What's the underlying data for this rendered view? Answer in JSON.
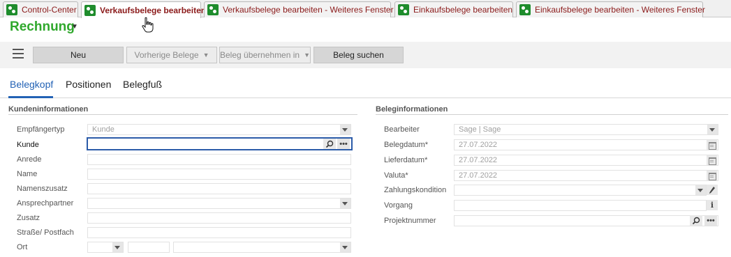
{
  "window_tabs": [
    {
      "label": "Control-Center",
      "icon": "app-icon",
      "active": false
    },
    {
      "label": "Verkaufsbelege bearbeiten",
      "icon": "app-icon",
      "active": true
    },
    {
      "label": "Verkaufsbelege bearbeiten - Weiteres Fenster",
      "icon": "app-icon",
      "active": false
    },
    {
      "label": "Einkaufsbelege bearbeiten",
      "icon": "app-icon",
      "active": false
    },
    {
      "label": "Einkaufsbelege bearbeiten - Weiteres Fenster",
      "icon": "app-icon",
      "active": false
    }
  ],
  "document": {
    "title": "Rechnung",
    "title_color": "#2fa82c"
  },
  "toolbar": {
    "menu_icon": "hamburger-icon",
    "new_label": "Neu",
    "previous_label": "Vorherige Belege",
    "take_over_label": "Beleg übernehmen in",
    "search_label": "Beleg suchen"
  },
  "section_tabs": [
    {
      "label": "Belegkopf",
      "active": true
    },
    {
      "label": "Positionen",
      "active": false
    },
    {
      "label": "Belegfuß",
      "active": false
    }
  ],
  "accent_color": "#2262b5",
  "customer": {
    "heading": "Kundeninformationen",
    "fields": {
      "recipient_type": {
        "label": "Empfängertyp",
        "value": "Kunde"
      },
      "customer": {
        "label": "Kunde",
        "value": ""
      },
      "salutation": {
        "label": "Anrede",
        "value": ""
      },
      "name": {
        "label": "Name",
        "value": ""
      },
      "name_suffix": {
        "label": "Namenszusatz",
        "value": ""
      },
      "contact": {
        "label": "Ansprechpartner",
        "value": ""
      },
      "addition": {
        "label": "Zusatz",
        "value": ""
      },
      "street": {
        "label": "Straße/ Postfach",
        "value": ""
      },
      "city": {
        "label": "Ort",
        "value": ""
      }
    }
  },
  "document_info": {
    "heading": "Beleginformationen",
    "fields": {
      "editor": {
        "label": "Bearbeiter",
        "value": "Sage  |  Sage"
      },
      "doc_date": {
        "label": "Belegdatum*",
        "value": "27.07.2022"
      },
      "delivery_date": {
        "label": "Lieferdatum*",
        "value": "27.07.2022"
      },
      "value_date": {
        "label": "Valuta*",
        "value": "27.07.2022"
      },
      "payment_terms": {
        "label": "Zahlungskondition",
        "value": ""
      },
      "process": {
        "label": "Vorgang",
        "value": ""
      },
      "project_number": {
        "label": "Projektnummer",
        "value": ""
      }
    }
  }
}
